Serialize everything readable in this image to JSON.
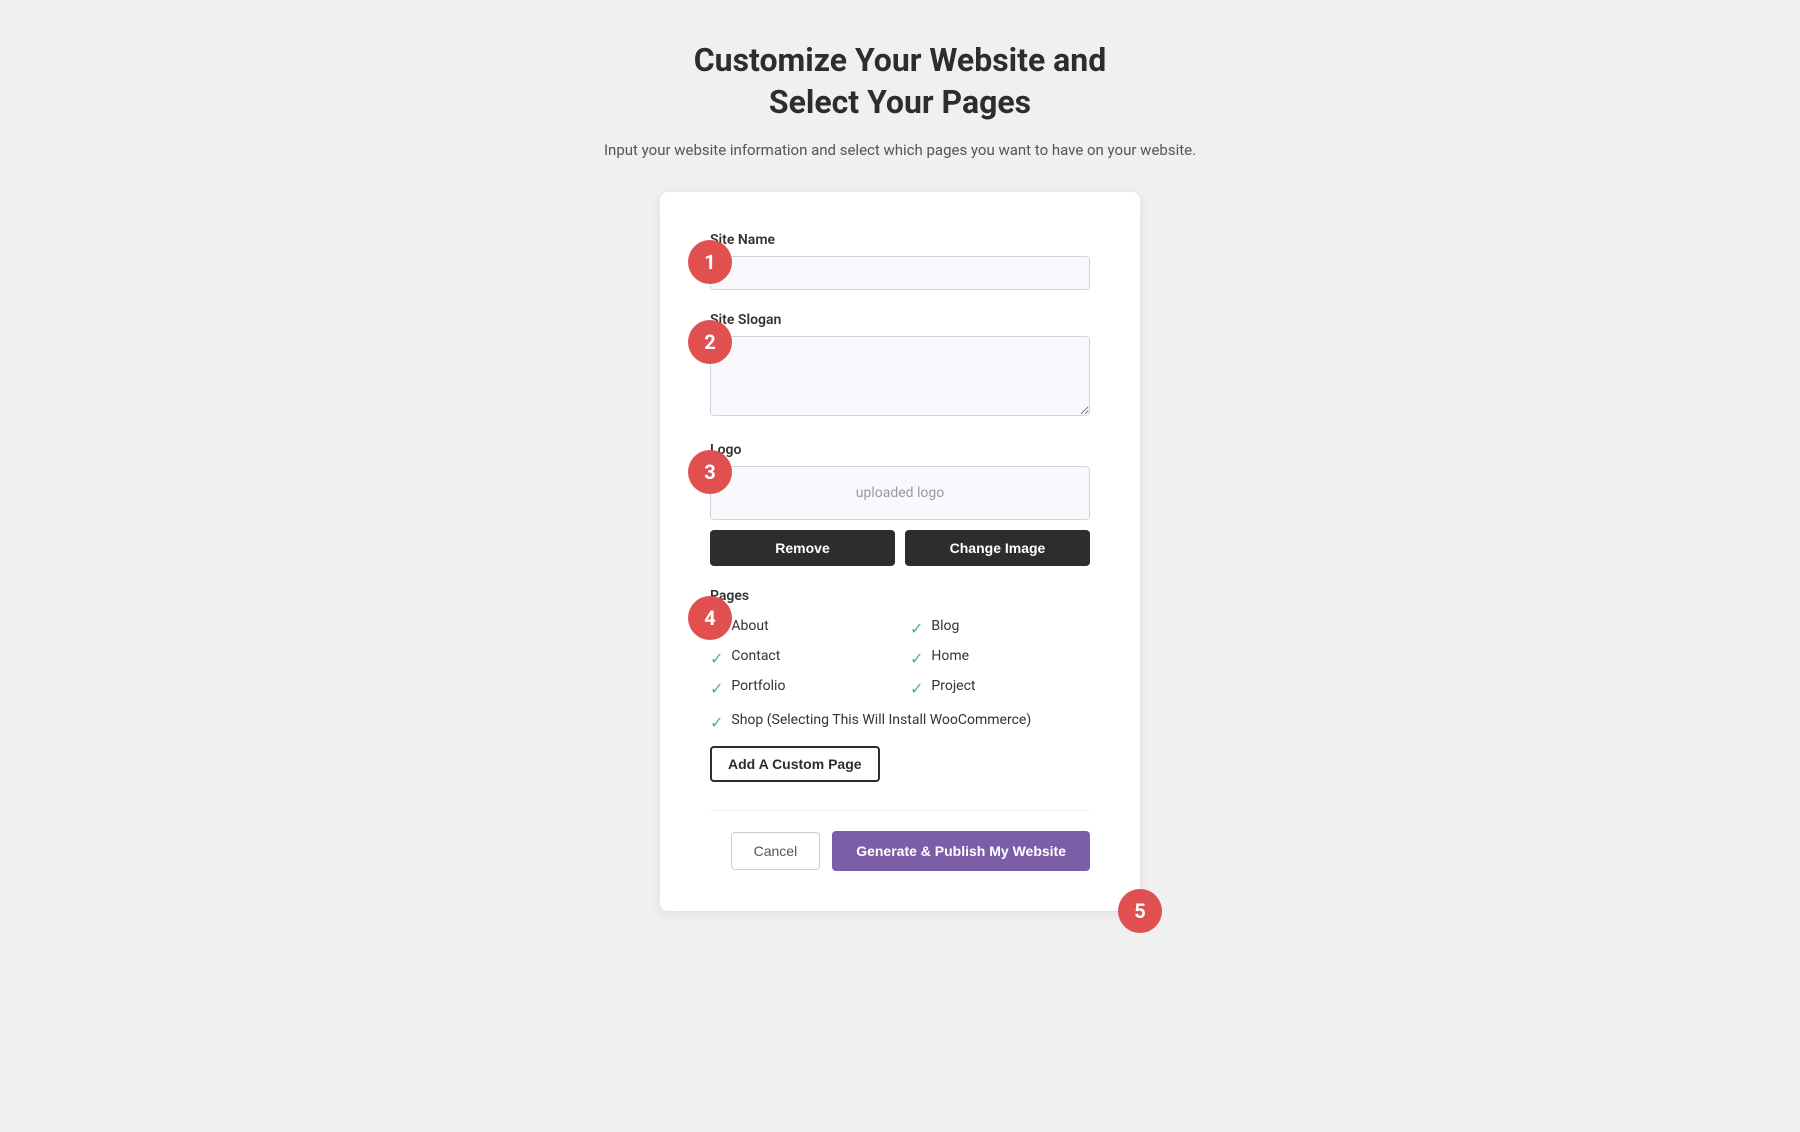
{
  "header": {
    "title_line1": "Customize Your Website and",
    "title_line2": "Select Your Pages",
    "subtitle": "Input your website information and select which pages you want to have on your website."
  },
  "form": {
    "site_name_label": "Site Name",
    "site_name_placeholder": "",
    "site_slogan_label": "Site Slogan",
    "site_slogan_placeholder": "",
    "logo_label": "Logo",
    "logo_preview_text": "uploaded logo",
    "remove_button": "Remove",
    "change_image_button": "Change Image",
    "pages_label": "Pages",
    "pages": [
      {
        "id": "about",
        "label": "About",
        "checked": true,
        "col": 1
      },
      {
        "id": "blog",
        "label": "Blog",
        "checked": true,
        "col": 2
      },
      {
        "id": "contact",
        "label": "Contact",
        "checked": true,
        "col": 1
      },
      {
        "id": "home",
        "label": "Home",
        "checked": true,
        "col": 2
      },
      {
        "id": "portfolio",
        "label": "Portfolio",
        "checked": true,
        "col": 1
      },
      {
        "id": "project",
        "label": "Project",
        "checked": true,
        "col": 2
      }
    ],
    "shop_page_label": "Shop (Selecting This Will Install WooCommerce)",
    "shop_checked": true,
    "add_custom_page_button": "Add A Custom Page",
    "cancel_button": "Cancel",
    "generate_button": "Generate & Publish My Website"
  },
  "steps": {
    "step1": "1",
    "step2": "2",
    "step3": "3",
    "step4": "4",
    "step5": "5"
  }
}
